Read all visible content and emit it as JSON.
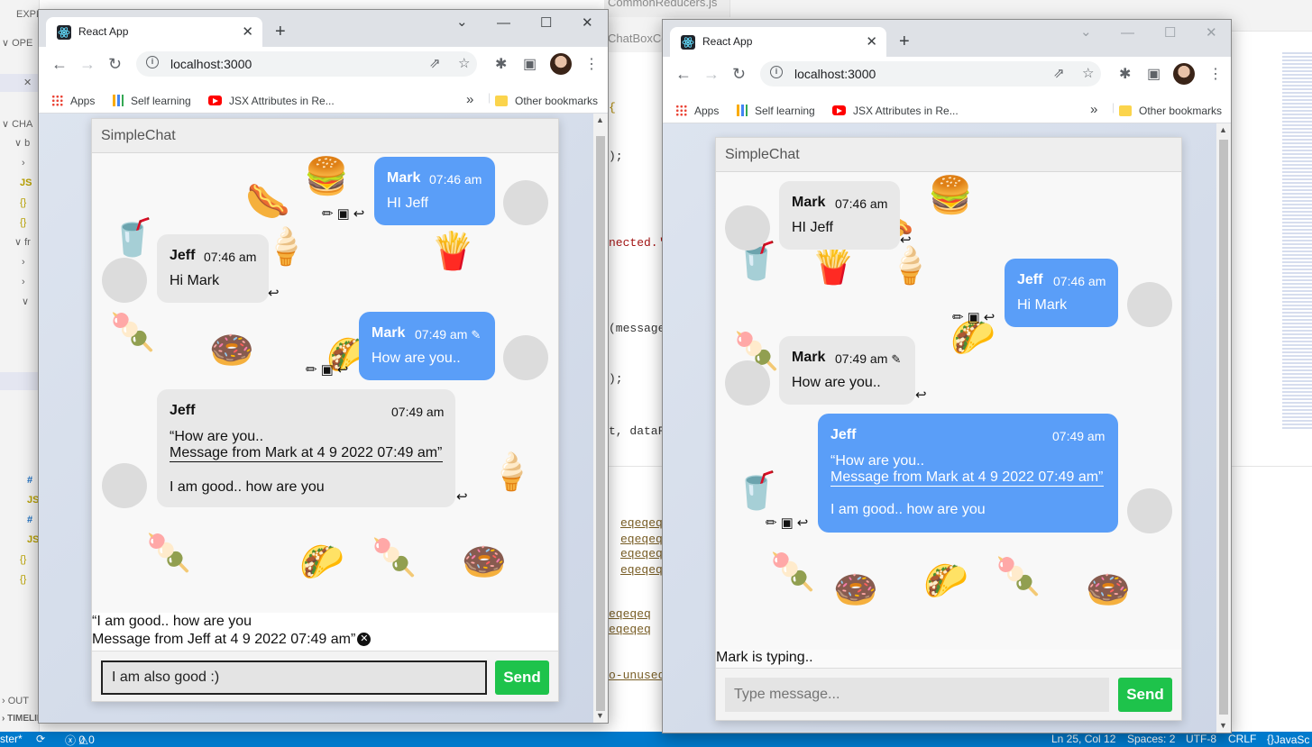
{
  "vscode": {
    "sidebar": {
      "explorer": "EXPL",
      "open_editors": "OPE",
      "chat_section": "CHA",
      "outline": "OUT",
      "timeline": "TIMELINE"
    },
    "tabs": [
      "CommonReducers.js",
      "ChatBoxCo"
    ],
    "code_lines": [
      ");",
      "nected.'",
      "(message",
      ");",
      "t, dataF"
    ],
    "problem_links": [
      "eqeqeq",
      "eqeqeq",
      "eqeqeq",
      "eqeqeq",
      "eqeqeq",
      "eqeqeq"
    ],
    "problem_tail": "o-unused-",
    "status": {
      "branch": "ster*",
      "errors": "0",
      "warnings": "0",
      "position": "Ln 25, Col 12",
      "spaces": "Spaces: 2",
      "encoding": "UTF-8",
      "eol": "CRLF",
      "language": "JavaSc"
    }
  },
  "browser": {
    "tab_title": "React App",
    "url": "localhost:3000",
    "bookmarks": {
      "apps": "Apps",
      "self_learning": "Self learning",
      "jsx": "JSX Attributes in Re...",
      "more": "»",
      "other": "Other bookmarks"
    }
  },
  "chat": {
    "title": "SimpleChat",
    "send_label": "Send",
    "window1": {
      "messages": [
        {
          "name": "Mark",
          "time": "07:46 am",
          "text": "HI Jeff"
        },
        {
          "name": "Jeff",
          "time": "07:46 am",
          "text": "Hi Mark"
        },
        {
          "name": "Mark",
          "time": "07:49 am",
          "text": "How are you.."
        },
        {
          "name": "Jeff",
          "time": "07:49 am",
          "quote_line1": "“How are you..",
          "quote_line2": "Message from Mark at 4 9 2022 07:49 am”",
          "text": "I am good.. how are you"
        }
      ],
      "reply_line1": "“I am good.. how are you",
      "reply_line2": "Message from Jeff at 4 9 2022 07:49 am”",
      "input_value": "I am also good :)"
    },
    "window2": {
      "messages": [
        {
          "name": "Mark",
          "time": "07:46 am",
          "text": "HI Jeff"
        },
        {
          "name": "Jeff",
          "time": "07:46 am",
          "text": "Hi Mark"
        },
        {
          "name": "Mark",
          "time": "07:49 am",
          "text": "How are you.."
        },
        {
          "name": "Jeff",
          "time": "07:49 am",
          "quote_line1": "“How are you..",
          "quote_line2": "Message from Mark at 4 9 2022 07:49 am”",
          "text": "I am good.. how are you"
        }
      ],
      "typing": "Mark is typing..",
      "input_placeholder": "Type message..."
    }
  },
  "icons": {
    "edit": "pencil-icon",
    "archive": "archive-icon",
    "reply": "reply-icon",
    "close": "close-icon"
  }
}
